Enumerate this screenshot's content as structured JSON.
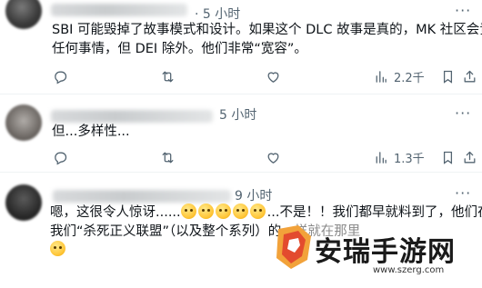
{
  "posts": [
    {
      "time": "· 5 小时",
      "lines": [
        "SBI 可能毁掉了故事模式和设计。如果这个 DLC 故事是真的，MK 社区会责怪",
        "任何事情，但 DEI 除外。他们非常“宽容”。"
      ],
      "views": "2.2千"
    },
    {
      "time": "5 小时",
      "lines": [
        "但...多样性..."
      ],
      "views": "1.3千"
    },
    {
      "time": "9 小时",
      "line1_prefix": "嗯，这很令人惊讶......",
      "line1_suffix": "...不是！！我们都早就料到了，他们在看到",
      "line2": "我们“杀死正义联盟”（以及整个系列）的",
      "line2_tail": "一样就在那里"
    }
  ],
  "watermark": {
    "title": "安瑞手游网",
    "url": "www.szerg.com"
  },
  "icons": {
    "reply": "reply-icon",
    "repost": "repost-icon",
    "like": "like-icon",
    "views": "views-icon",
    "bookmark": "bookmark-icon",
    "share": "share-icon",
    "more": "more-icon"
  },
  "colors": {
    "text": "#0f1419",
    "muted": "#536471",
    "divider": "#eff3f4"
  }
}
